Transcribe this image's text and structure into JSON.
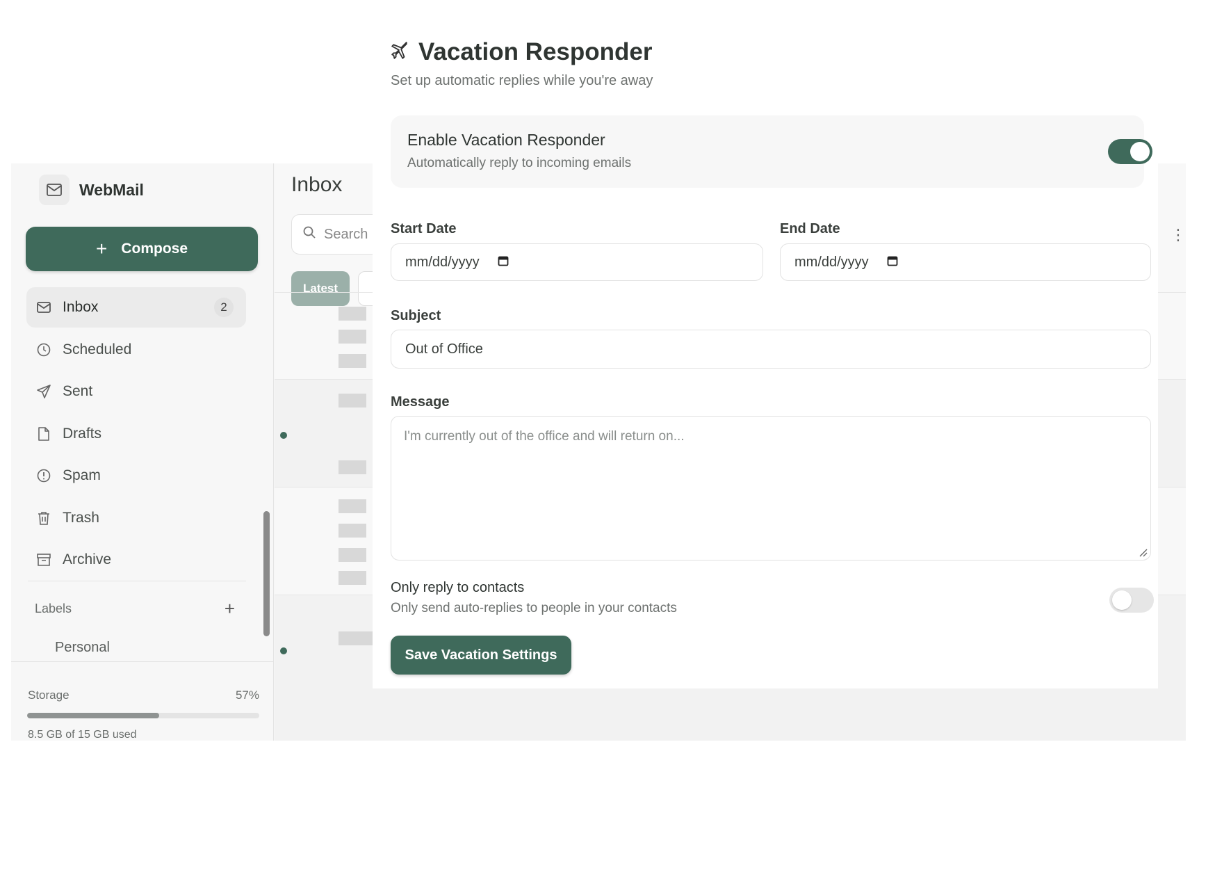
{
  "app": {
    "name": "WebMail",
    "compose_label": "Compose",
    "nav": [
      {
        "label": "Inbox",
        "badge": "2",
        "icon": "inbox-icon",
        "active": true
      },
      {
        "label": "Scheduled",
        "icon": "clock-icon"
      },
      {
        "label": "Sent",
        "icon": "send-icon"
      },
      {
        "label": "Drafts",
        "icon": "file-icon"
      },
      {
        "label": "Spam",
        "icon": "alert-circle-icon"
      },
      {
        "label": "Trash",
        "icon": "trash-icon"
      },
      {
        "label": "Archive",
        "icon": "archive-icon"
      }
    ],
    "labels_heading": "Labels",
    "labels": [
      "Personal"
    ],
    "storage": {
      "label": "Storage",
      "percent_text": "57%",
      "percent": 57,
      "used_text": "8.5 GB of 15 GB used"
    }
  },
  "mail": {
    "title": "Inbox",
    "search_placeholder": "Search",
    "filter_latest": "Latest"
  },
  "vacation": {
    "title": "Vacation Responder",
    "subtitle": "Set up automatic replies while you're away",
    "enable_title": "Enable Vacation Responder",
    "enable_desc": "Automatically reply to incoming emails",
    "enabled": true,
    "start_label": "Start Date",
    "start_value": "mm/dd/yyyy",
    "end_label": "End Date",
    "end_value": "mm/dd/yyyy",
    "subject_label": "Subject",
    "subject_value": "Out of Office",
    "message_label": "Message",
    "message_placeholder": "I'm currently out of the office and will return on...",
    "contacts_title": "Only reply to contacts",
    "contacts_desc": "Only send auto-replies to people in your contacts",
    "contacts_only": false,
    "save_label": "Save Vacation Settings"
  },
  "colors": {
    "accent": "#3f6a5b",
    "chip": "#9bb0a9"
  }
}
